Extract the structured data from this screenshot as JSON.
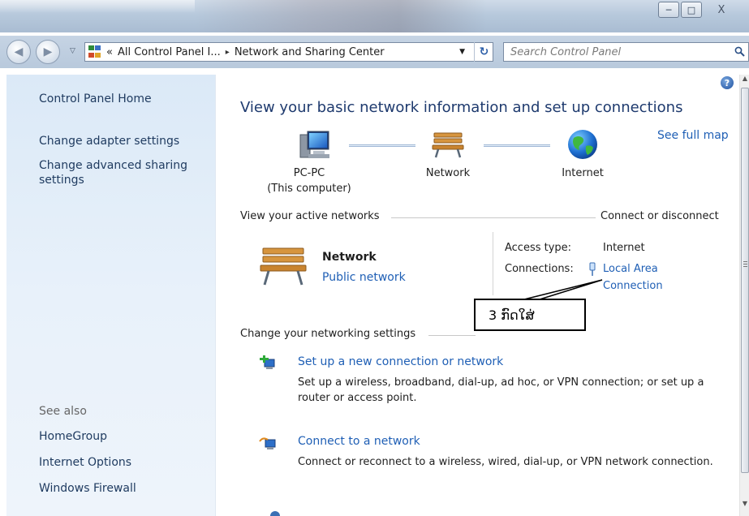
{
  "window": {
    "minimize_glyph": "─",
    "maximize_glyph": "□",
    "close_glyph": "X"
  },
  "navigation": {
    "back_glyph": "◀",
    "forward_glyph": "▶",
    "history_dropdown_glyph": "▽"
  },
  "address": {
    "overflow_glyph": "«",
    "crumbs": [
      "All Control Panel I...",
      "Network and Sharing Center"
    ],
    "separator_glyph": "▸",
    "dropdown_glyph": "▼",
    "refresh_glyph": "↻"
  },
  "search": {
    "placeholder": "Search Control Panel"
  },
  "sidebar": {
    "home_label": "Control Panel Home",
    "links": [
      "Change adapter settings",
      "Change advanced sharing settings"
    ],
    "see_also_label": "See also",
    "see_also_links": [
      "HomeGroup",
      "Internet Options",
      "Windows Firewall"
    ]
  },
  "main": {
    "help_glyph": "?",
    "title": "View your basic network information and set up connections",
    "see_full_map": "See full map",
    "map": {
      "computer_name": "PC-PC",
      "computer_sub": "(This computer)",
      "network": "Network",
      "internet": "Internet"
    },
    "active_networks": {
      "heading": "View your active networks",
      "connect_link": "Connect or disconnect",
      "network_name": "Network",
      "network_type": "Public network",
      "access_type_label": "Access type:",
      "access_type_value": "Internet",
      "connections_label": "Connections:",
      "connection_line1": "Local Area",
      "connection_line2": "Connection"
    },
    "annotation": {
      "text": "3 ກົດໃສ່"
    },
    "settings": {
      "heading": "Change your networking settings",
      "tasks": [
        {
          "title": "Set up a new connection or network",
          "description": "Set up a wireless, broadband, dial-up, ad hoc, or VPN connection; or set up a router or access point."
        },
        {
          "title": "Connect to a network",
          "description": "Connect or reconnect to a wireless, wired, dial-up, or VPN network connection."
        }
      ]
    }
  },
  "scrollbar": {
    "up_glyph": "▲",
    "down_glyph": "▼"
  },
  "colors": {
    "link": "#1f5fb5",
    "title": "#1e3a6e",
    "sidebar_bg": "#dbe9f7"
  }
}
